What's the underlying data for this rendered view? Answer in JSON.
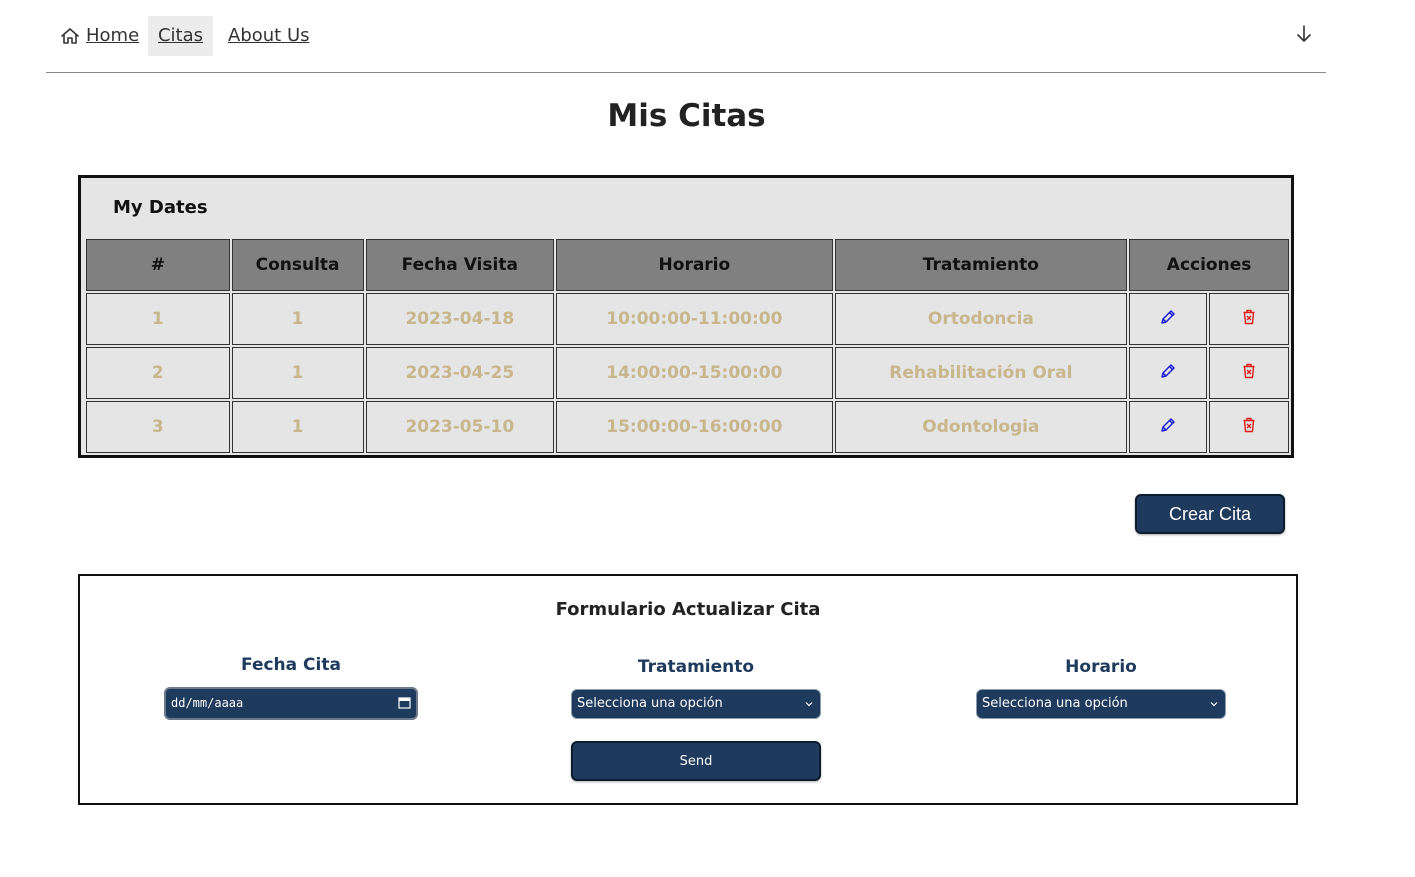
{
  "nav": {
    "home_label": "Home",
    "citas_label": "Citas",
    "about_label": "About Us"
  },
  "page": {
    "title": "Mis Citas"
  },
  "table": {
    "caption": "My Dates",
    "headers": [
      "#",
      "Consulta",
      "Fecha Visita",
      "Horario",
      "Tratamiento",
      "Acciones"
    ],
    "rows": [
      {
        "num": "1",
        "consulta": "1",
        "fecha": "2023-04-18",
        "horario": "10:00:00-11:00:00",
        "tratamiento": "Ortodoncia"
      },
      {
        "num": "2",
        "consulta": "1",
        "fecha": "2023-04-25",
        "horario": "14:00:00-15:00:00",
        "tratamiento": "Rehabilitación Oral"
      },
      {
        "num": "3",
        "consulta": "1",
        "fecha": "2023-05-10",
        "horario": "15:00:00-16:00:00",
        "tratamiento": "Odontologia"
      }
    ],
    "edit_icon": "pencil-icon",
    "delete_icon": "trash-icon",
    "edit_color": "#1a1adb",
    "delete_color": "#e01b1b",
    "cell_text_color": "#c8b68c",
    "header_bg": "#808080"
  },
  "actions": {
    "crear_label": "Crear Cita"
  },
  "form": {
    "title": "Formulario Actualizar Cita",
    "fecha_label": "Fecha Cita",
    "fecha_placeholder": "dd/mm/aaaa",
    "tratamiento_label": "Tratamiento",
    "tratamiento_value": "Selecciona una opción",
    "horario_label": "Horario",
    "horario_value": "Selecciona una opción",
    "send_label": "Send"
  },
  "colors": {
    "accent": "#1e3a5c"
  }
}
